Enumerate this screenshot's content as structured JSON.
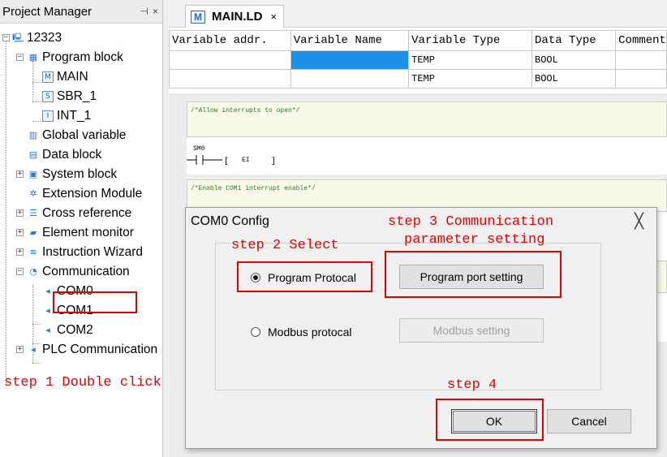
{
  "project_manager": {
    "title": "Project Manager",
    "pin_icon": "pin-icon",
    "close_glyph": "×",
    "tree": {
      "root": "12323",
      "program_block": "Program block",
      "main": "MAIN",
      "sbr": "SBR_1",
      "int": "INT_1",
      "global_vars": "Global variable",
      "data_block": "Data block",
      "system_block": "System block",
      "extension": "Extension Module",
      "cross_ref": "Cross reference",
      "element_mon": "Element monitor",
      "instruction": "Instruction Wizard",
      "communication": "Communication",
      "com0": "COM0",
      "com1": "COM1",
      "com2": "COM2",
      "plc_comm": "PLC Communication"
    }
  },
  "editor": {
    "tab_label": "MAIN.LD",
    "tab_close": "×",
    "table": {
      "headers": [
        "Variable addr.",
        "Variable Name",
        "Variable Type",
        "Data Type",
        "Comment"
      ],
      "rows": [
        [
          "",
          "",
          "TEMP",
          "BOOL",
          ""
        ],
        [
          "",
          "",
          "TEMP",
          "BOOL",
          ""
        ]
      ]
    },
    "ladder": {
      "comment1": "/*Allow interrupts to open*/",
      "contact_label": "SM0",
      "coil": "EI",
      "comment2": "/*Enable COM1 interrupt enable*/"
    }
  },
  "dialog": {
    "title": "COM0 Config",
    "close_glyph": "╳",
    "radio_program": "Program Protocal",
    "radio_modbus": "Modbus protocal",
    "program_selected": true,
    "btn_program_port": "Program port setting",
    "btn_modbus": "Modbus setting",
    "btn_ok": "OK",
    "btn_cancel": "Cancel"
  },
  "annotations": {
    "step1": "step 1 Double click",
    "step2": "step 2 Select",
    "step3_line1": "step 3 Communication",
    "step3_line2": "parameter setting",
    "step4": "step 4",
    "color": "#e00000"
  }
}
